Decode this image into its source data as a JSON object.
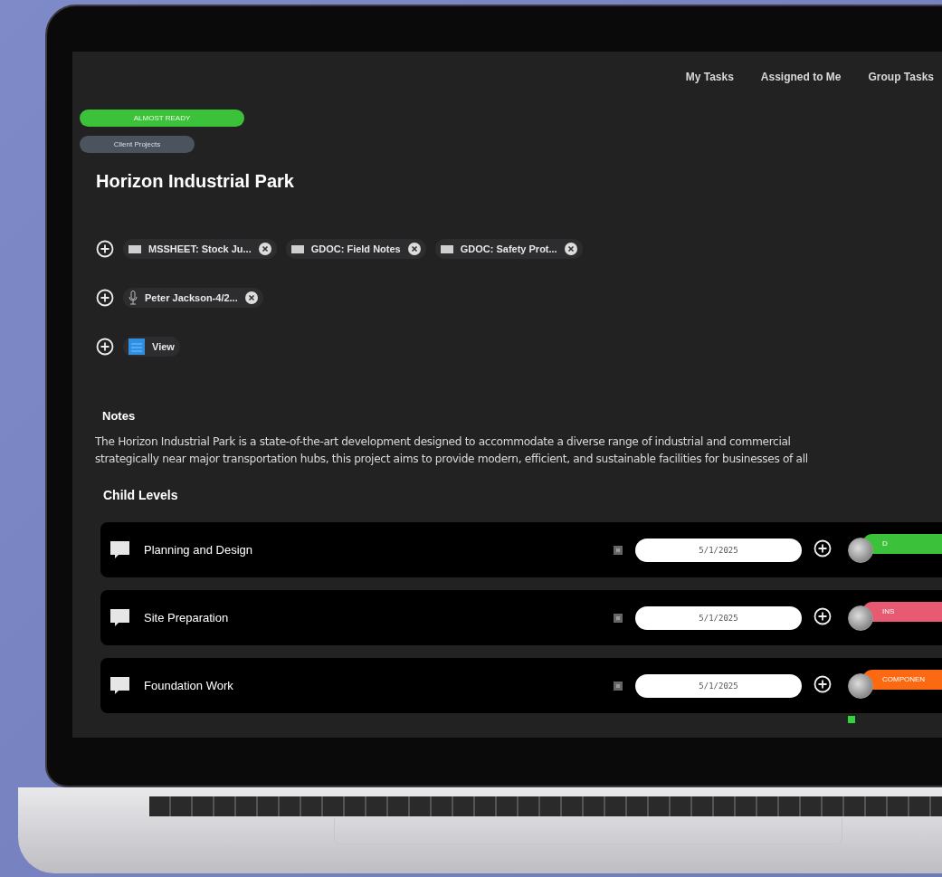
{
  "nav": [
    {
      "label": "My Tasks"
    },
    {
      "label": "Assigned to Me"
    },
    {
      "label": "Group Tasks"
    }
  ],
  "status_badge": "ALMOST READY",
  "category_tag": "Client Projects",
  "title": "Horizon Industrial Park",
  "attachment_rows": [
    {
      "chips": [
        {
          "kind": "sheet",
          "label": "MSSHEET: Stock Ju..."
        },
        {
          "kind": "doc",
          "label": "GDOC: Field Notes"
        },
        {
          "kind": "doc",
          "label": "GDOC: Safety Prot..."
        }
      ]
    },
    {
      "chips": [
        {
          "kind": "audio",
          "label": "Peter Jackson-4/2..."
        }
      ]
    },
    {
      "chips": [
        {
          "kind": "view",
          "label": "View"
        }
      ]
    }
  ],
  "notes": {
    "heading": "Notes",
    "lines": [
      "The Horizon Industrial Park is a state-of-the-art development designed to accommodate a diverse range of industrial and commercial",
      "strategically near major transportation hubs, this project aims to provide modern, efficient, and sustainable facilities for businesses of all"
    ]
  },
  "child_levels": {
    "heading": "Child Levels",
    "rows": [
      {
        "name": "Planning and Design",
        "date": "5/1/2025",
        "status": "D",
        "color": "#3cc13b",
        "marker": false
      },
      {
        "name": "Site Preparation",
        "date": "5/1/2025",
        "status": "INS",
        "color": "#e85a72",
        "marker": false
      },
      {
        "name": "Foundation Work",
        "date": "5/1/2025",
        "status": "COMPONEN",
        "color": "#fb6a12",
        "marker": true
      }
    ]
  }
}
